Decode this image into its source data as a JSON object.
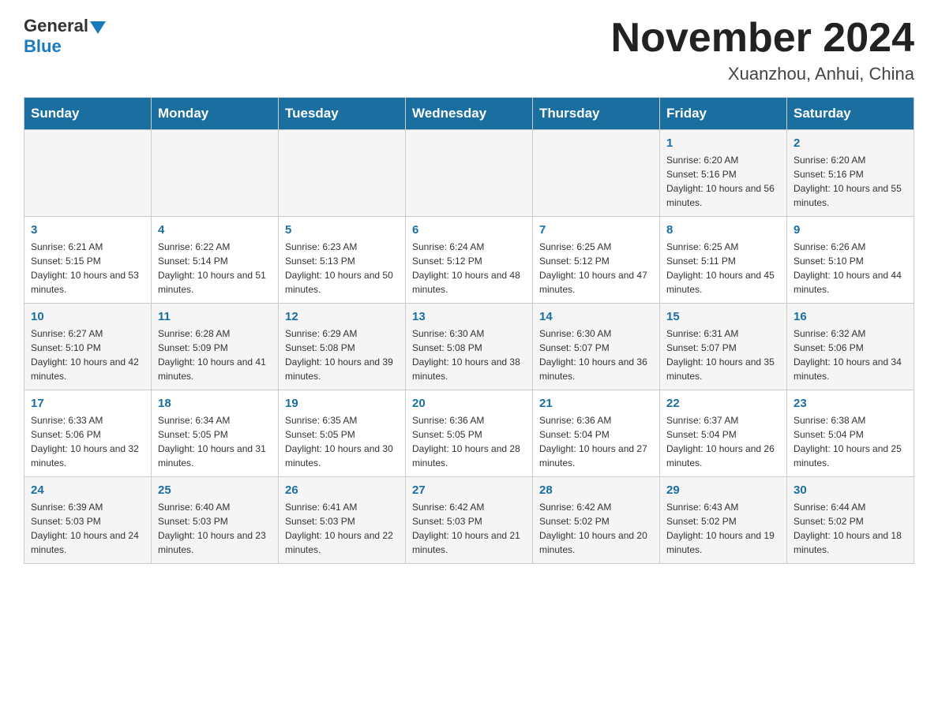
{
  "header": {
    "logo_general": "General",
    "logo_blue": "Blue",
    "title": "November 2024",
    "subtitle": "Xuanzhou, Anhui, China"
  },
  "weekdays": [
    "Sunday",
    "Monday",
    "Tuesday",
    "Wednesday",
    "Thursday",
    "Friday",
    "Saturday"
  ],
  "weeks": [
    [
      {
        "day": "",
        "info": ""
      },
      {
        "day": "",
        "info": ""
      },
      {
        "day": "",
        "info": ""
      },
      {
        "day": "",
        "info": ""
      },
      {
        "day": "",
        "info": ""
      },
      {
        "day": "1",
        "info": "Sunrise: 6:20 AM\nSunset: 5:16 PM\nDaylight: 10 hours and 56 minutes."
      },
      {
        "day": "2",
        "info": "Sunrise: 6:20 AM\nSunset: 5:16 PM\nDaylight: 10 hours and 55 minutes."
      }
    ],
    [
      {
        "day": "3",
        "info": "Sunrise: 6:21 AM\nSunset: 5:15 PM\nDaylight: 10 hours and 53 minutes."
      },
      {
        "day": "4",
        "info": "Sunrise: 6:22 AM\nSunset: 5:14 PM\nDaylight: 10 hours and 51 minutes."
      },
      {
        "day": "5",
        "info": "Sunrise: 6:23 AM\nSunset: 5:13 PM\nDaylight: 10 hours and 50 minutes."
      },
      {
        "day": "6",
        "info": "Sunrise: 6:24 AM\nSunset: 5:12 PM\nDaylight: 10 hours and 48 minutes."
      },
      {
        "day": "7",
        "info": "Sunrise: 6:25 AM\nSunset: 5:12 PM\nDaylight: 10 hours and 47 minutes."
      },
      {
        "day": "8",
        "info": "Sunrise: 6:25 AM\nSunset: 5:11 PM\nDaylight: 10 hours and 45 minutes."
      },
      {
        "day": "9",
        "info": "Sunrise: 6:26 AM\nSunset: 5:10 PM\nDaylight: 10 hours and 44 minutes."
      }
    ],
    [
      {
        "day": "10",
        "info": "Sunrise: 6:27 AM\nSunset: 5:10 PM\nDaylight: 10 hours and 42 minutes."
      },
      {
        "day": "11",
        "info": "Sunrise: 6:28 AM\nSunset: 5:09 PM\nDaylight: 10 hours and 41 minutes."
      },
      {
        "day": "12",
        "info": "Sunrise: 6:29 AM\nSunset: 5:08 PM\nDaylight: 10 hours and 39 minutes."
      },
      {
        "day": "13",
        "info": "Sunrise: 6:30 AM\nSunset: 5:08 PM\nDaylight: 10 hours and 38 minutes."
      },
      {
        "day": "14",
        "info": "Sunrise: 6:30 AM\nSunset: 5:07 PM\nDaylight: 10 hours and 36 minutes."
      },
      {
        "day": "15",
        "info": "Sunrise: 6:31 AM\nSunset: 5:07 PM\nDaylight: 10 hours and 35 minutes."
      },
      {
        "day": "16",
        "info": "Sunrise: 6:32 AM\nSunset: 5:06 PM\nDaylight: 10 hours and 34 minutes."
      }
    ],
    [
      {
        "day": "17",
        "info": "Sunrise: 6:33 AM\nSunset: 5:06 PM\nDaylight: 10 hours and 32 minutes."
      },
      {
        "day": "18",
        "info": "Sunrise: 6:34 AM\nSunset: 5:05 PM\nDaylight: 10 hours and 31 minutes."
      },
      {
        "day": "19",
        "info": "Sunrise: 6:35 AM\nSunset: 5:05 PM\nDaylight: 10 hours and 30 minutes."
      },
      {
        "day": "20",
        "info": "Sunrise: 6:36 AM\nSunset: 5:05 PM\nDaylight: 10 hours and 28 minutes."
      },
      {
        "day": "21",
        "info": "Sunrise: 6:36 AM\nSunset: 5:04 PM\nDaylight: 10 hours and 27 minutes."
      },
      {
        "day": "22",
        "info": "Sunrise: 6:37 AM\nSunset: 5:04 PM\nDaylight: 10 hours and 26 minutes."
      },
      {
        "day": "23",
        "info": "Sunrise: 6:38 AM\nSunset: 5:04 PM\nDaylight: 10 hours and 25 minutes."
      }
    ],
    [
      {
        "day": "24",
        "info": "Sunrise: 6:39 AM\nSunset: 5:03 PM\nDaylight: 10 hours and 24 minutes."
      },
      {
        "day": "25",
        "info": "Sunrise: 6:40 AM\nSunset: 5:03 PM\nDaylight: 10 hours and 23 minutes."
      },
      {
        "day": "26",
        "info": "Sunrise: 6:41 AM\nSunset: 5:03 PM\nDaylight: 10 hours and 22 minutes."
      },
      {
        "day": "27",
        "info": "Sunrise: 6:42 AM\nSunset: 5:03 PM\nDaylight: 10 hours and 21 minutes."
      },
      {
        "day": "28",
        "info": "Sunrise: 6:42 AM\nSunset: 5:02 PM\nDaylight: 10 hours and 20 minutes."
      },
      {
        "day": "29",
        "info": "Sunrise: 6:43 AM\nSunset: 5:02 PM\nDaylight: 10 hours and 19 minutes."
      },
      {
        "day": "30",
        "info": "Sunrise: 6:44 AM\nSunset: 5:02 PM\nDaylight: 10 hours and 18 minutes."
      }
    ]
  ]
}
